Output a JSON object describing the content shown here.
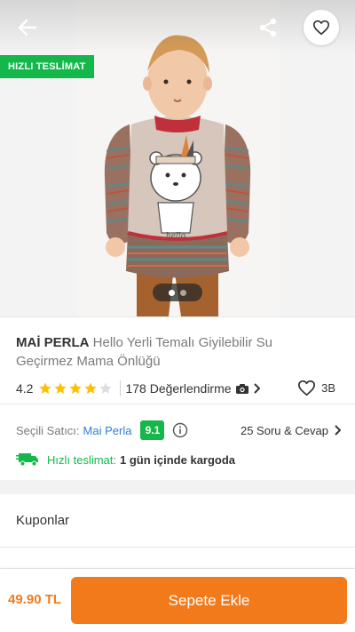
{
  "header": {
    "badge": "HIZLI TESLİMAT",
    "icons": [
      "arrow-left-icon",
      "share-icon",
      "heart-icon"
    ],
    "gallery_total": 2,
    "gallery_active": 1
  },
  "product": {
    "brand": "MAİ PERLA",
    "name": "Hello Yerli Temalı Giyilebilir Su Geçirmez Mama Önlüğü",
    "rating": "4.2",
    "rating_value": 4.2,
    "reviews": "178 Değerlendirme",
    "likes": "3B"
  },
  "seller": {
    "label": "Seçili Satıcı:",
    "name": "Mai Perla",
    "score": "9.1",
    "qa": "25 Soru & Cevap",
    "delivery_label": "Hızlı teslimat:",
    "delivery_text": "1 gün içinde kargoda"
  },
  "coupons": {
    "label": "Kuponlar"
  },
  "bottom": {
    "price": "49.90 TL",
    "add_label": "Sepete Ekle"
  },
  "colors": {
    "brand_orange": "#f27a1a",
    "green": "#14b84a",
    "link_blue": "#2f7fd6",
    "star": "#ffc000"
  }
}
